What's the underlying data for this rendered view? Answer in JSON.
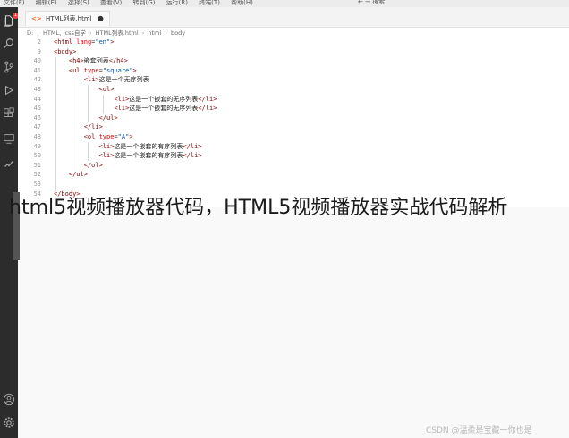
{
  "menu": {
    "items": [
      "文件(F)",
      "编辑(E)",
      "选择(S)",
      "查看(V)",
      "转到(G)",
      "运行(R)",
      "终端(T)",
      "帮助(H)"
    ],
    "search_label": "搜索"
  },
  "activity_bar": {
    "icons": [
      "explorer-icon",
      "search-icon",
      "source-control-icon",
      "run-debug-icon",
      "extensions-icon",
      "remote-explorer-icon",
      "testing-icon"
    ],
    "badge": "1",
    "bottom_icons": [
      "account-icon",
      "manage-gear-icon"
    ]
  },
  "tab": {
    "label": "HTML列表.html",
    "modified": "●"
  },
  "breadcrumb": {
    "items": [
      "D:",
      "HTML、css自学",
      "HTML列表.html",
      "html",
      "body"
    ]
  },
  "editor": {
    "lines": [
      {
        "n": "2",
        "html": "<span class='tag'>&lt;html</span> <span class='attr'>lang</span>=<span class='val'>\"en\"</span><span class='tag'>&gt;</span>"
      },
      {
        "n": "9",
        "html": "<span class='tag'>&lt;body&gt;</span>"
      },
      {
        "n": "40",
        "html": "&nbsp;&nbsp;&nbsp;&nbsp;<span class='tag'>&lt;h4&gt;</span><span class='txt'>嵌套列表</span><span class='tag'>&lt;/h4&gt;</span>"
      },
      {
        "n": "41",
        "html": "&nbsp;&nbsp;&nbsp;&nbsp;<span class='tag'>&lt;ul</span> <span class='attr'>type</span>=<span class='val'>\"square\"</span><span class='tag'>&gt;</span>"
      },
      {
        "n": "42",
        "html": "&nbsp;&nbsp;&nbsp;&nbsp;&nbsp;&nbsp;&nbsp;&nbsp;<span class='tag'>&lt;li&gt;</span><span class='txt'>这是一个无序列表</span>"
      },
      {
        "n": "43",
        "html": "&nbsp;&nbsp;&nbsp;&nbsp;&nbsp;&nbsp;&nbsp;&nbsp;&nbsp;&nbsp;&nbsp;&nbsp;<span class='tag'>&lt;ul&gt;</span>"
      },
      {
        "n": "44",
        "html": "&nbsp;&nbsp;&nbsp;&nbsp;&nbsp;&nbsp;&nbsp;&nbsp;&nbsp;&nbsp;&nbsp;&nbsp;&nbsp;&nbsp;&nbsp;&nbsp;<span class='tag'>&lt;li&gt;</span><span class='txt'>这是一个嵌套的无序列表</span><span class='tag'>&lt;/li&gt;</span>"
      },
      {
        "n": "45",
        "html": "&nbsp;&nbsp;&nbsp;&nbsp;&nbsp;&nbsp;&nbsp;&nbsp;&nbsp;&nbsp;&nbsp;&nbsp;&nbsp;&nbsp;&nbsp;&nbsp;<span class='tag'>&lt;li&gt;</span><span class='txt'>这是一个嵌套的无序列表</span><span class='tag'>&lt;/li&gt;</span>"
      },
      {
        "n": "46",
        "html": "&nbsp;&nbsp;&nbsp;&nbsp;&nbsp;&nbsp;&nbsp;&nbsp;&nbsp;&nbsp;&nbsp;&nbsp;<span class='tag'>&lt;/ul&gt;</span>"
      },
      {
        "n": "47",
        "html": "&nbsp;&nbsp;&nbsp;&nbsp;&nbsp;&nbsp;&nbsp;&nbsp;<span class='tag'>&lt;/li&gt;</span>"
      },
      {
        "n": "48",
        "html": "&nbsp;&nbsp;&nbsp;&nbsp;&nbsp;&nbsp;&nbsp;&nbsp;<span class='tag'>&lt;ol</span> <span class='attr'>type</span>=<span class='val'>\"A\"</span><span class='tag'>&gt;</span>"
      },
      {
        "n": "49",
        "html": "&nbsp;&nbsp;&nbsp;&nbsp;&nbsp;&nbsp;&nbsp;&nbsp;&nbsp;&nbsp;&nbsp;&nbsp;<span class='tag'>&lt;li&gt;</span><span class='txt'>这是一个嵌套的有序列表</span><span class='tag'>&lt;/li&gt;</span>"
      },
      {
        "n": "50",
        "html": "&nbsp;&nbsp;&nbsp;&nbsp;&nbsp;&nbsp;&nbsp;&nbsp;&nbsp;&nbsp;&nbsp;&nbsp;<span class='tag'>&lt;li&gt;</span><span class='txt'>这是一个嵌套的有序列表</span><span class='tag'>&lt;/li&gt;</span>"
      },
      {
        "n": "51",
        "html": "&nbsp;&nbsp;&nbsp;&nbsp;&nbsp;&nbsp;&nbsp;&nbsp;<span class='tag'>&lt;/ol&gt;</span>"
      },
      {
        "n": "52",
        "html": "&nbsp;&nbsp;&nbsp;&nbsp;<span class='tag'>&lt;/ul&gt;</span>"
      },
      {
        "n": "53",
        "html": ""
      },
      {
        "n": "54",
        "html": "<span class='tag'>&lt;/body&gt;</span>"
      }
    ]
  },
  "overlay_title": "html5视频播放器代码，HTML5视频播放器实战代码解析",
  "watermark": "CSDN @温柔是宝藏一你也是"
}
